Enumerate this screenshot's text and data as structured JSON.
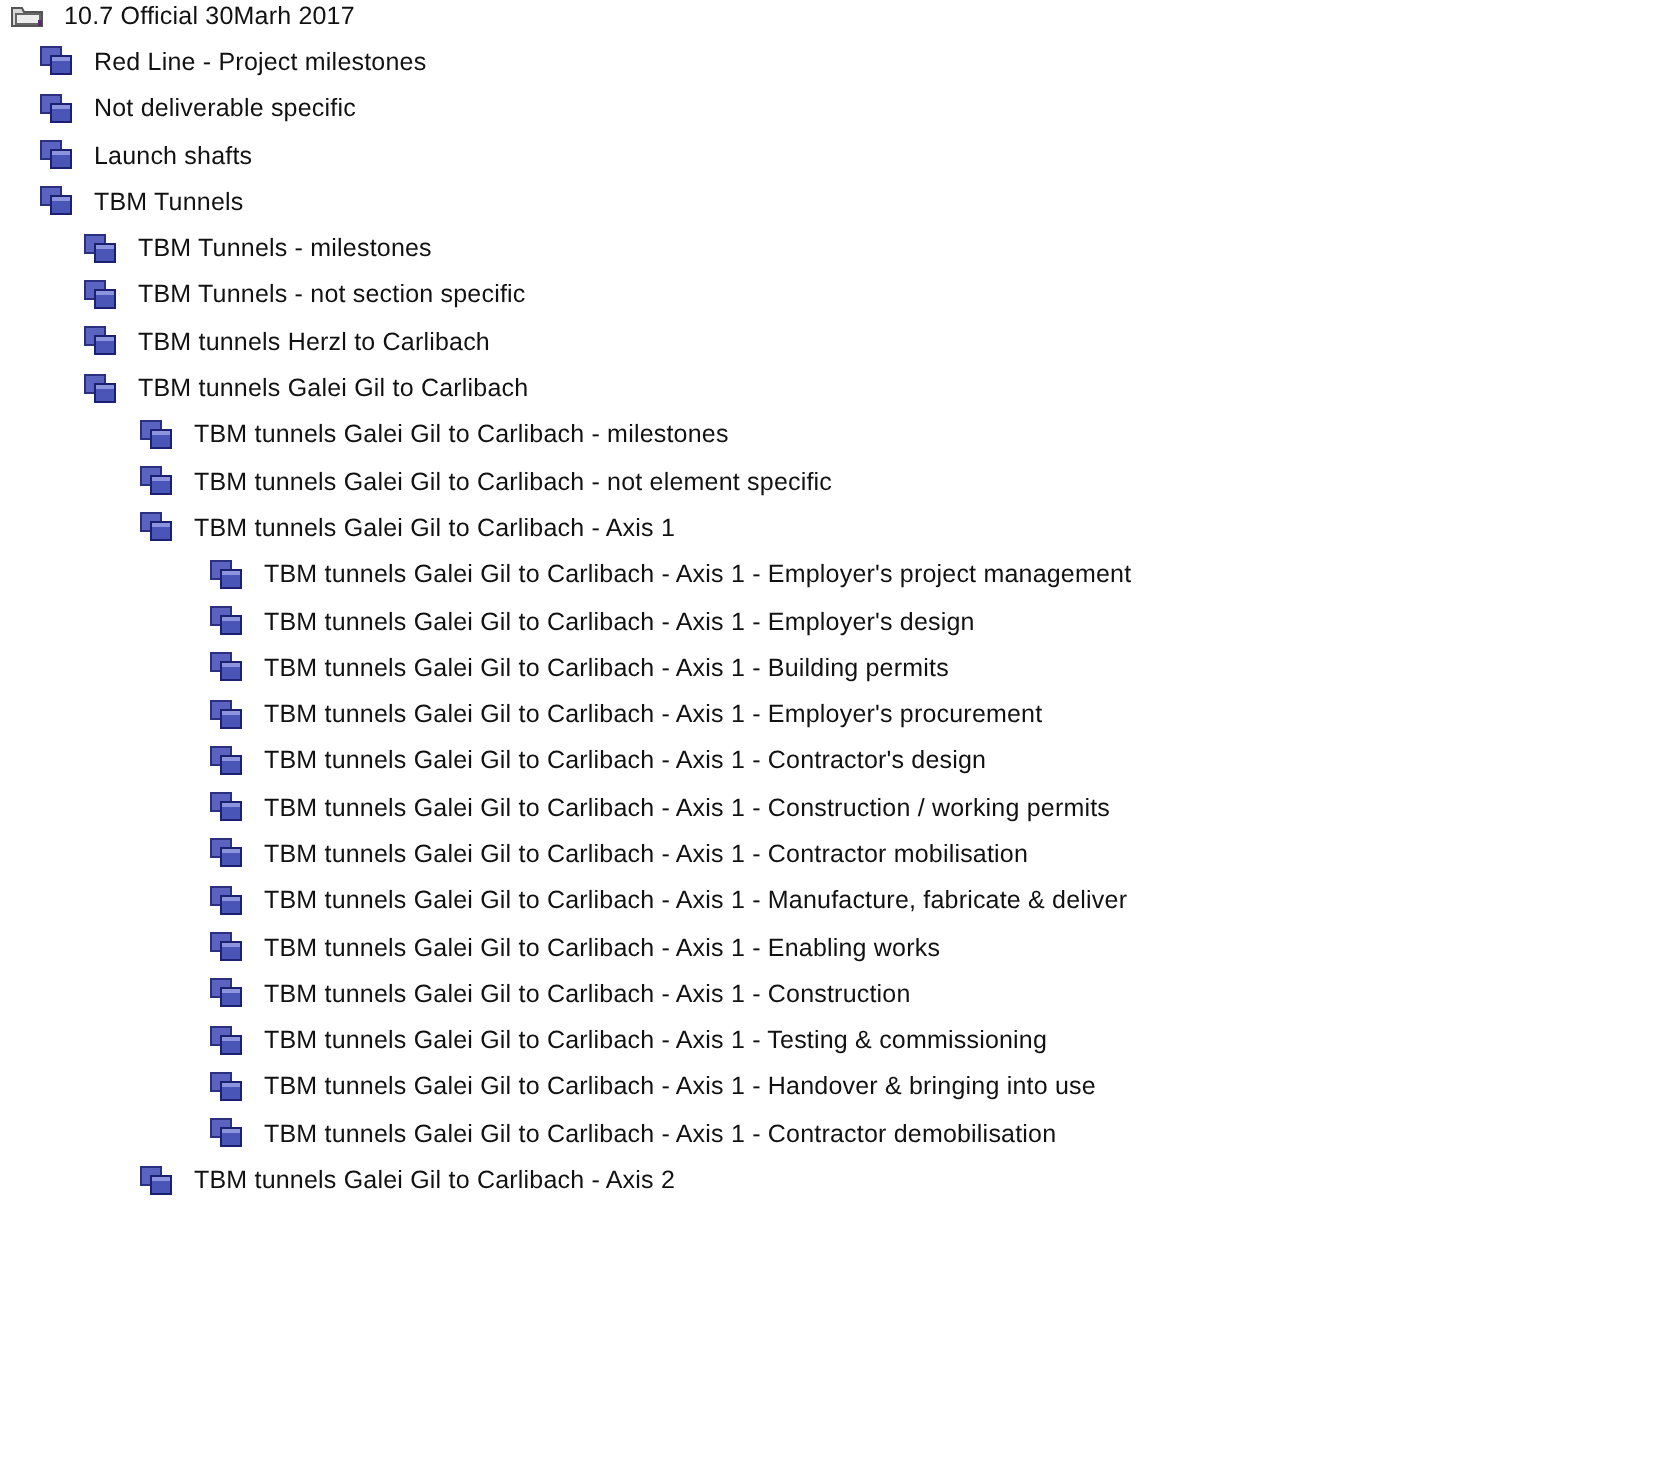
{
  "tree": [
    {
      "label": "10.7 Official 30Marh 2017",
      "children": [
        {
          "label": "Red Line - Project milestones"
        },
        {
          "label": "Not deliverable specific"
        },
        {
          "label": "Launch shafts"
        },
        {
          "label": "TBM Tunnels",
          "children": [
            {
              "label": "TBM Tunnels - milestones"
            },
            {
              "label": "TBM Tunnels - not section specific"
            },
            {
              "label": "TBM tunnels Herzl to Carlibach"
            },
            {
              "label": "TBM tunnels Galei Gil to Carlibach",
              "children": [
                {
                  "label": "TBM tunnels Galei Gil to Carlibach - milestones"
                },
                {
                  "label": "TBM tunnels Galei Gil to Carlibach - not element specific"
                },
                {
                  "label": "TBM tunnels Galei Gil to Carlibach - Axis 1",
                  "children": [
                    {
                      "label": "TBM tunnels Galei Gil to Carlibach - Axis 1 - Employer's project management"
                    },
                    {
                      "label": "TBM tunnels Galei Gil to Carlibach - Axis 1 - Employer's design"
                    },
                    {
                      "label": "TBM tunnels Galei Gil to Carlibach - Axis 1 - Building permits"
                    },
                    {
                      "label": "TBM tunnels Galei Gil to Carlibach - Axis 1 - Employer's procurement"
                    },
                    {
                      "label": "TBM tunnels Galei Gil to Carlibach - Axis 1 - Contractor's design"
                    },
                    {
                      "label": "TBM tunnels Galei Gil to Carlibach - Axis 1 - Construction / working permits"
                    },
                    {
                      "label": "TBM tunnels Galei Gil to Carlibach - Axis 1 - Contractor mobilisation"
                    },
                    {
                      "label": "TBM tunnels Galei Gil to Carlibach - Axis 1 - Manufacture, fabricate & deliver"
                    },
                    {
                      "label": "TBM tunnels Galei Gil to Carlibach - Axis 1 - Enabling works"
                    },
                    {
                      "label": "TBM tunnels Galei Gil to Carlibach - Axis 1 - Construction"
                    },
                    {
                      "label": "TBM tunnels Galei Gil to Carlibach - Axis 1 - Testing & commissioning"
                    },
                    {
                      "label": "TBM tunnels Galei Gil to Carlibach - Axis 1 - Handover & bringing into use"
                    },
                    {
                      "label": "TBM tunnels Galei Gil to Carlibach - Axis 1 - Contractor demobilisation"
                    }
                  ]
                },
                {
                  "label": "TBM tunnels Galei Gil to Carlibach - Axis 2"
                }
              ]
            }
          ]
        }
      ]
    }
  ]
}
